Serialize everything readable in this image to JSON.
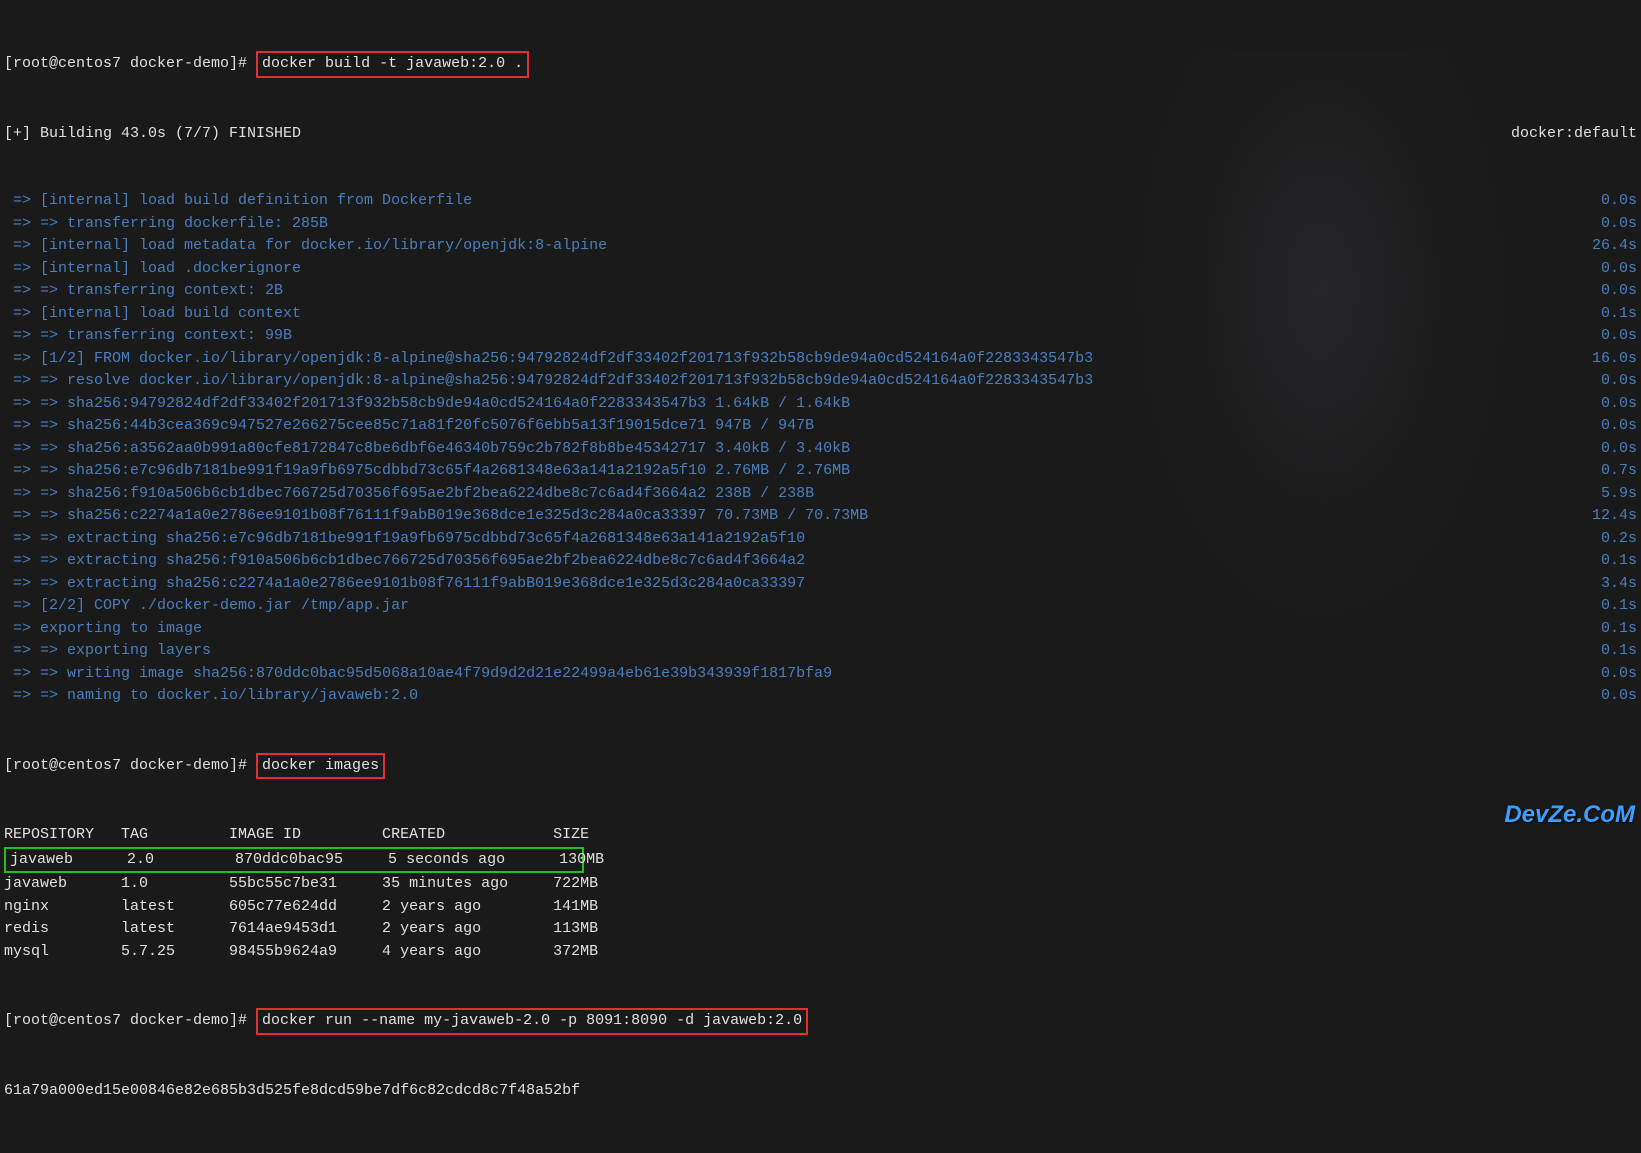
{
  "prompt1_prefix": "[root@centos7 docker-demo]# ",
  "cmd_build": "docker build -t javaweb:2.0 .",
  "build_header": "[+] Building 43.0s (7/7) FINISHED",
  "build_backend": "docker:default",
  "steps": [
    {
      "text": " => [internal] load build definition from Dockerfile",
      "time": "0.0s"
    },
    {
      "text": " => => transferring dockerfile: 285B",
      "time": "0.0s"
    },
    {
      "text": " => [internal] load metadata for docker.io/library/openjdk:8-alpine",
      "time": "26.4s"
    },
    {
      "text": " => [internal] load .dockerignore",
      "time": "0.0s"
    },
    {
      "text": " => => transferring context: 2B",
      "time": "0.0s"
    },
    {
      "text": " => [internal] load build context",
      "time": "0.1s"
    },
    {
      "text": " => => transferring context: 99B",
      "time": "0.0s"
    },
    {
      "text": " => [1/2] FROM docker.io/library/openjdk:8-alpine@sha256:94792824df2df33402f201713f932b58cb9de94a0cd524164a0f2283343547b3",
      "time": "16.0s"
    },
    {
      "text": " => => resolve docker.io/library/openjdk:8-alpine@sha256:94792824df2df33402f201713f932b58cb9de94a0cd524164a0f2283343547b3",
      "time": "0.0s"
    },
    {
      "text": " => => sha256:94792824df2df33402f201713f932b58cb9de94a0cd524164a0f2283343547b3 1.64kB / 1.64kB",
      "time": "0.0s"
    },
    {
      "text": " => => sha256:44b3cea369c947527e266275cee85c71a81f20fc5076f6ebb5a13f19015dce71 947B / 947B",
      "time": "0.0s"
    },
    {
      "text": " => => sha256:a3562aa0b991a80cfe8172847c8be6dbf6e46340b759c2b782f8b8be45342717 3.40kB / 3.40kB",
      "time": "0.0s"
    },
    {
      "text": " => => sha256:e7c96db7181be991f19a9fb6975cdbbd73c65f4a2681348e63a141a2192a5f10 2.76MB / 2.76MB",
      "time": "0.7s"
    },
    {
      "text": " => => sha256:f910a506b6cb1dbec766725d70356f695ae2bf2bea6224dbe8c7c6ad4f3664a2 238B / 238B",
      "time": "5.9s"
    },
    {
      "text": " => => sha256:c2274a1a0e2786ee9101b08f76111f9abB019e368dce1e325d3c284a0ca33397 70.73MB / 70.73MB",
      "time": "12.4s"
    },
    {
      "text": " => => extracting sha256:e7c96db7181be991f19a9fb6975cdbbd73c65f4a2681348e63a141a2192a5f10",
      "time": "0.2s"
    },
    {
      "text": " => => extracting sha256:f910a506b6cb1dbec766725d70356f695ae2bf2bea6224dbe8c7c6ad4f3664a2",
      "time": "0.1s"
    },
    {
      "text": " => => extracting sha256:c2274a1a0e2786ee9101b08f76111f9abB019e368dce1e325d3c284a0ca33397",
      "time": "3.4s"
    },
    {
      "text": " => [2/2] COPY ./docker-demo.jar /tmp/app.jar",
      "time": "0.1s"
    },
    {
      "text": " => exporting to image",
      "time": "0.1s"
    },
    {
      "text": " => => exporting layers",
      "time": "0.1s"
    },
    {
      "text": " => => writing image sha256:870ddc0bac95d5068a10ae4f79d9d2d21e22499a4eb61e39b343939f1817bfa9",
      "time": "0.0s"
    },
    {
      "text": " => => naming to docker.io/library/javaweb:2.0",
      "time": "0.0s"
    }
  ],
  "prompt2_prefix": "[root@centos7 docker-demo]# ",
  "cmd_images": "docker images",
  "images_header": {
    "repo": "REPOSITORY",
    "tag": "TAG",
    "id": "IMAGE ID",
    "created": "CREATED",
    "size": "SIZE"
  },
  "images": [
    {
      "repo": "javaweb",
      "tag": "2.0",
      "id": "870ddc0bac95",
      "created": "5 seconds ago",
      "size": "130MB",
      "hl": true
    },
    {
      "repo": "javaweb",
      "tag": "1.0",
      "id": "55bc55c7be31",
      "created": "35 minutes ago",
      "size": "722MB"
    },
    {
      "repo": "nginx",
      "tag": "latest",
      "id": "605c77e624dd",
      "created": "2 years ago",
      "size": "141MB"
    },
    {
      "repo": "redis",
      "tag": "latest",
      "id": "7614ae9453d1",
      "created": "2 years ago",
      "size": "113MB"
    },
    {
      "repo": "mysql",
      "tag": "5.7.25",
      "id": "98455b9624a9",
      "created": "4 years ago",
      "size": "372MB"
    }
  ],
  "prompt3_prefix": "[root@centos7 docker-demo]# ",
  "cmd_run": "docker run --name my-javaweb-2.0 -p 8091:8090 -d javaweb:2.0",
  "container_id": "61a79a000ed15e00846e82e685b3d525fe8dcd59be7df6c82cdcd8c7f48a52bf",
  "watermark": "DevZe.CoM"
}
